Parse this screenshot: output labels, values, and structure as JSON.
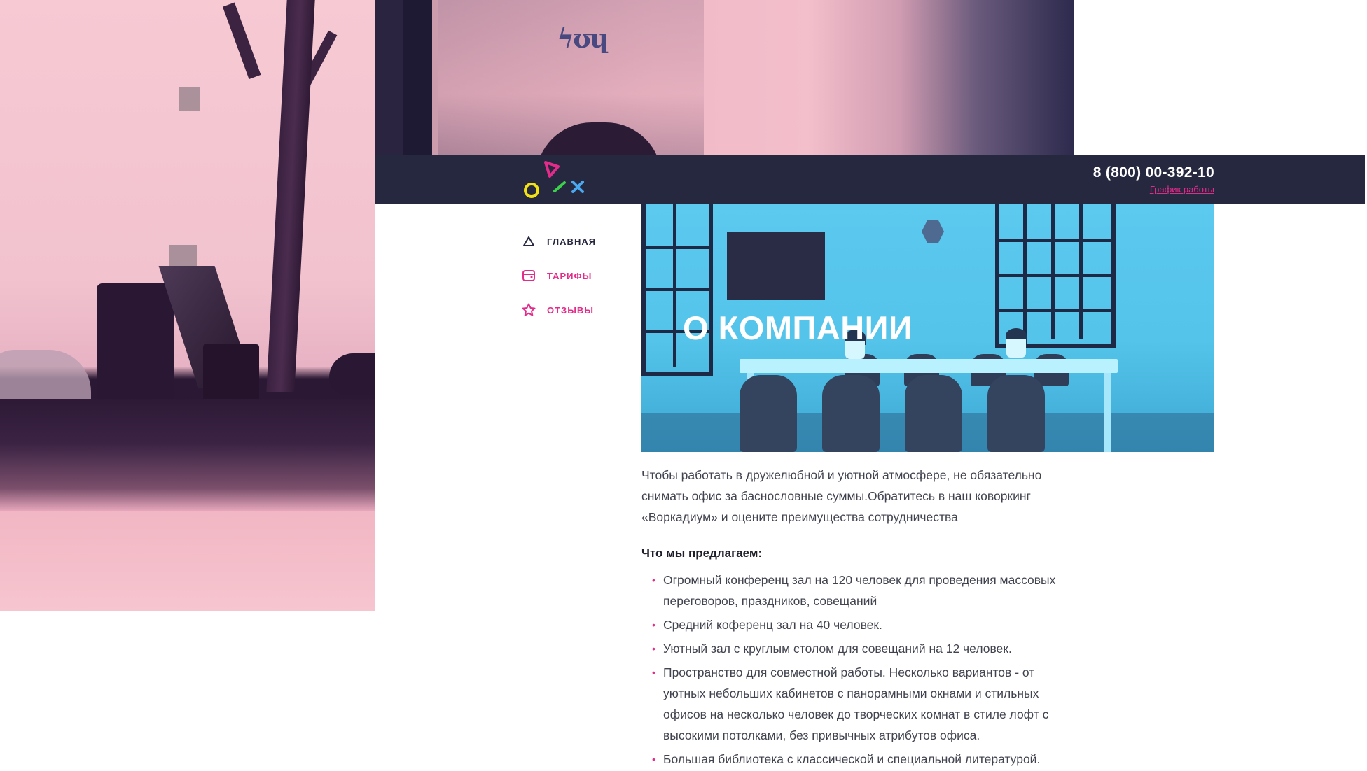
{
  "colors": {
    "header_bg": "#262840",
    "accent_pink": "#e52b8a",
    "hero_blue": "#5cc9ef",
    "text": "#41434f",
    "logo_yellow": "#f3e213",
    "logo_pink": "#e52b8a",
    "logo_green": "#3bd14a",
    "logo_blue": "#4aa8f0"
  },
  "background": {
    "sign_text": "ϟʊɥ"
  },
  "header": {
    "phone": "8 (800) 00-392-10",
    "schedule_link": "График работы"
  },
  "nav": {
    "items": [
      {
        "label": "ГЛАВНАЯ",
        "icon": "triangle-icon"
      },
      {
        "label": "ТАРИФЫ",
        "icon": "wallet-icon"
      },
      {
        "label": "ОТЗЫВЫ",
        "icon": "star-icon"
      }
    ]
  },
  "hero": {
    "title": "О КОМПАНИИ"
  },
  "article": {
    "intro_lines": [
      "Чтобы работать в дружелюбной и уютной атмосфере, не обязательно",
      "снимать офис за баснословные суммы.Обратитесь в наш коворкинг",
      "«Воркадиум» и оцените преимущества сотрудничества"
    ],
    "offer_title": "Что мы предлагаем:",
    "offers": [
      {
        "lines": [
          "Огромный конференц зал на 120 человек для проведения массовых",
          "переговоров, праздников, совещаний"
        ]
      },
      {
        "lines": [
          "Средний коференц зал на 40 человек."
        ]
      },
      {
        "lines": [
          "Уютный зал с круглым столом для совещаний на 12 человек."
        ]
      },
      {
        "lines": [
          "Пространство для совместной работы. Несколько вариантов - от",
          "уютных небольших кабинетов с панорамными окнами и стильных",
          "офисов на несколько человек до творческих комнат в стиле лофт с",
          "высокими потолками, без привычных атрибутов офиса."
        ]
      },
      {
        "lines": [
          "Большая библиотека с классической и специальной литературой."
        ]
      }
    ]
  }
}
